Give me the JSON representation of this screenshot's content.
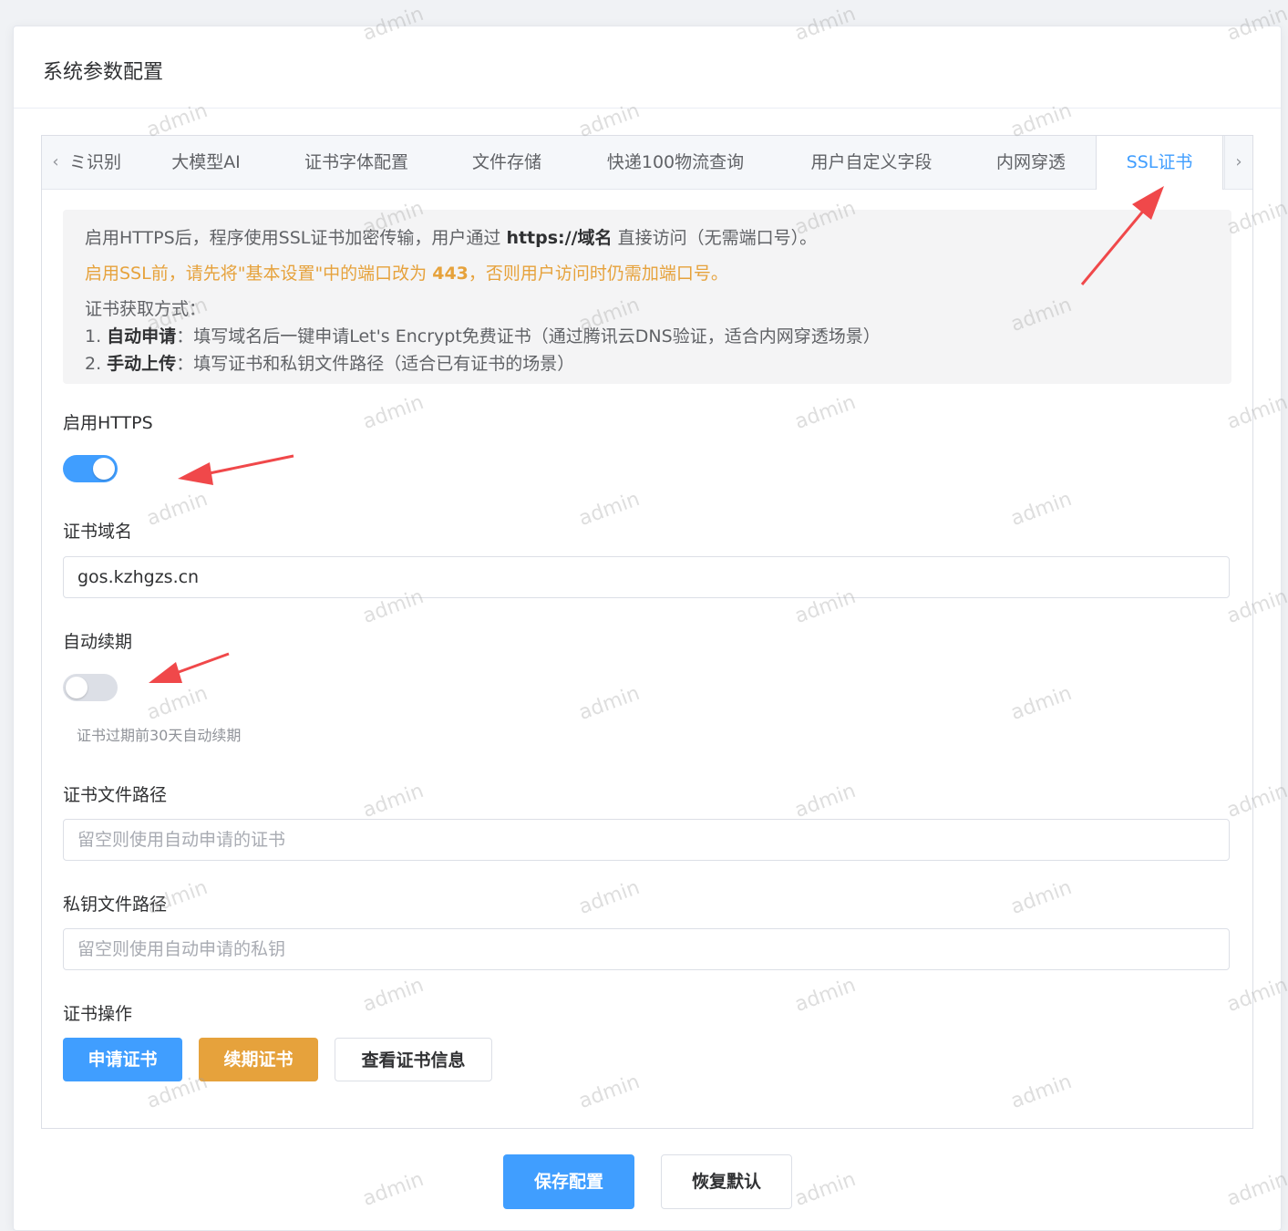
{
  "page_title": "系统参数配置",
  "tabs": {
    "items": [
      {
        "label": "ミ识别"
      },
      {
        "label": "大模型AI"
      },
      {
        "label": "证书字体配置"
      },
      {
        "label": "文件存储"
      },
      {
        "label": "快递100物流查询"
      },
      {
        "label": "用户自定义字段"
      },
      {
        "label": "内网穿透"
      },
      {
        "label": "SSL证书",
        "active": true
      }
    ],
    "prev_icon": "‹",
    "next_icon": "›"
  },
  "alert": {
    "line1_prefix": "启用HTTPS后，程序使用SSL证书加密传输，用户通过 ",
    "line1_bold": "https://域名",
    "line1_suffix": " 直接访问（无需端口号）。",
    "line2_prefix": "启用SSL前，请先将\"基本设置\"中的端口改为 ",
    "line2_bold": "443",
    "line2_suffix": "，否则用户访问时仍需加端口号。",
    "line3": "证书获取方式：",
    "line4_prefix": "1. ",
    "line4_bold": "自动申请",
    "line4_suffix": "：填写域名后一键申请Let's Encrypt免费证书（通过腾讯云DNS验证，适合内网穿透场景）",
    "line5_prefix": "2. ",
    "line5_bold": "手动上传",
    "line5_suffix": "：填写证书和私钥文件路径（适合已有证书的场景）"
  },
  "form": {
    "enable_https_label": "启用HTTPS",
    "enable_https_on": true,
    "domain_label": "证书域名",
    "domain_value": "gos.kzhgzs.cn",
    "auto_renew_label": "自动续期",
    "auto_renew_on": false,
    "auto_renew_hint": "证书过期前30天自动续期",
    "cert_path_label": "证书文件路径",
    "cert_path_placeholder": "留空则使用自动申请的证书",
    "key_path_label": "私钥文件路径",
    "key_path_placeholder": "留空则使用自动申请的私钥",
    "cert_ops_label": "证书操作",
    "apply_button": "申请证书",
    "renew_button": "续期证书",
    "view_button": "查看证书信息"
  },
  "footer": {
    "save_button": "保存配置",
    "reset_button": "恢复默认"
  },
  "watermark_text": "admin",
  "colors": {
    "primary": "#409eff",
    "warning": "#e6a23c",
    "annotation_arrow": "#f0484a"
  }
}
